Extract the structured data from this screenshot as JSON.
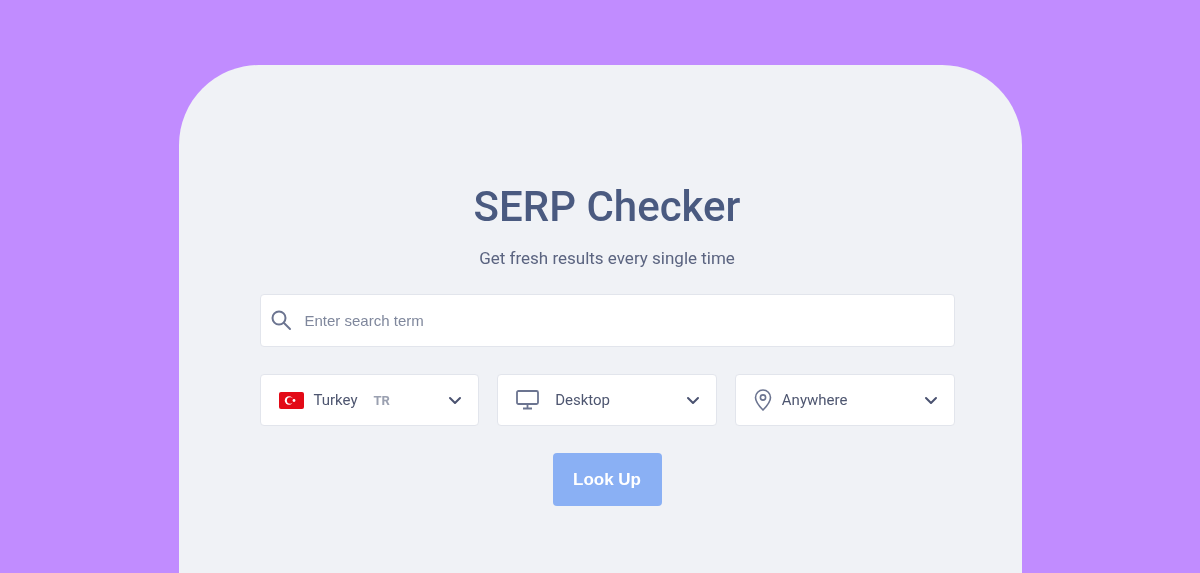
{
  "title": "SERP Checker",
  "subtitle": "Get fresh results every single time",
  "search": {
    "placeholder": "Enter search term"
  },
  "selects": [
    {
      "kind": "country",
      "label": "Turkey",
      "code": "TR"
    },
    {
      "kind": "device",
      "label": "Desktop"
    },
    {
      "kind": "location",
      "label": "Anywhere"
    }
  ],
  "button": "Look Up"
}
